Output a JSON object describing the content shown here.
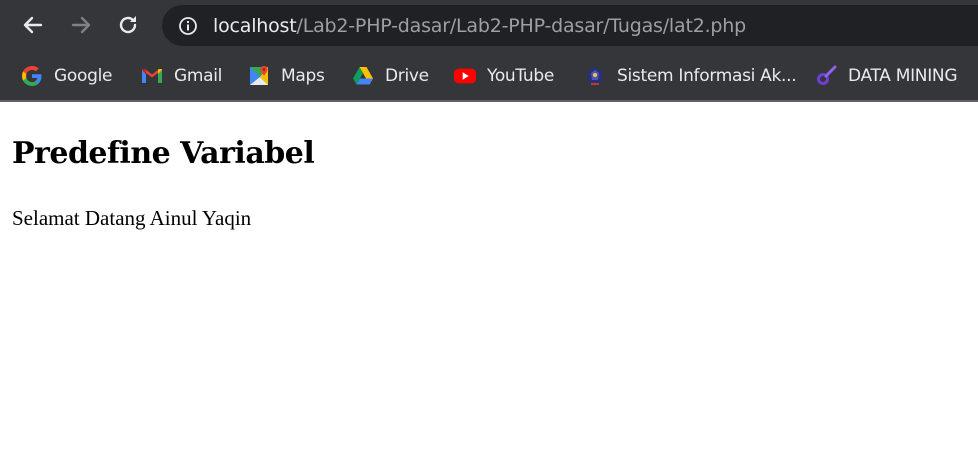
{
  "browser": {
    "address_bar": {
      "host": "localhost",
      "path": "/Lab2-PHP-dasar/Lab2-PHP-dasar/Tugas/lat2.php"
    },
    "bookmarks": [
      {
        "label": "Google",
        "icon": "google-icon"
      },
      {
        "label": "Gmail",
        "icon": "gmail-icon"
      },
      {
        "label": "Maps",
        "icon": "maps-icon"
      },
      {
        "label": "Drive",
        "icon": "drive-icon"
      },
      {
        "label": "YouTube",
        "icon": "youtube-icon"
      },
      {
        "label": "Sistem Informasi Ak...",
        "icon": "university-logo-icon"
      },
      {
        "label": "DATA MINING",
        "icon": "data-mining-icon"
      }
    ],
    "colors": {
      "toolbar": "#35363a",
      "omnibox": "#202124",
      "host_text": "#e8eaed",
      "path_text": "#9aa0a6"
    }
  },
  "page": {
    "heading": "Predefine Variabel",
    "text": "Selamat Datang Ainul Yaqin"
  }
}
